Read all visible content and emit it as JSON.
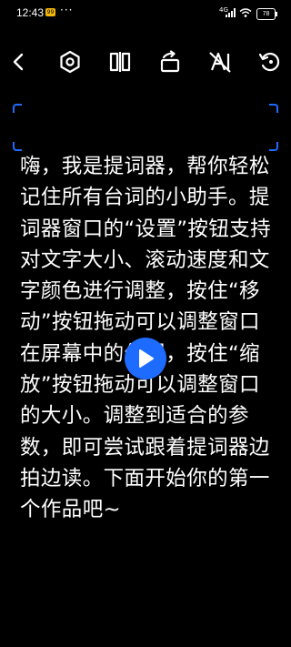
{
  "status_bar": {
    "time": "12:43",
    "notification_badge": "99",
    "overflow_dots": "···",
    "network": "4G",
    "battery": "78"
  },
  "toolbar": {
    "icons": [
      "back-arrow-icon",
      "settings-hexagon-icon",
      "mirror-flip-icon",
      "rotate-icon",
      "text-color-off-icon",
      "reset-icon"
    ]
  },
  "prompter": {
    "text": "嗨，我是提词器，帮你轻松记住所有台词的小助手。提词器窗口的“设置”按钮支持对文字大小、滚动速度和文字颜色进行调整，按住“移动”按钮拖动可以调整窗口在屏幕中的位置，按住“缩放”按钮拖动可以调整窗口的大小。调整到适合的参数，即可尝试跟着提词器边拍边读。下面开始你的第一个作品吧~"
  },
  "colors": {
    "background": "#000000",
    "accent": "#1e6cff",
    "text": "#ffffff"
  }
}
